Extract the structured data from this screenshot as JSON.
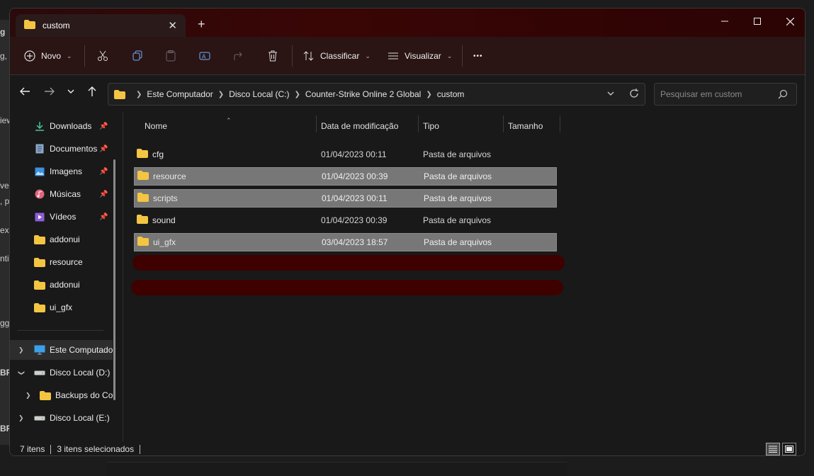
{
  "background": {
    "fragments": [
      "g",
      "g, c",
      "iew",
      "ve",
      ", p",
      "ex",
      "nti",
      "gg",
      "BR",
      "BR"
    ]
  },
  "window": {
    "tab_title": "custom",
    "new_tab": "+"
  },
  "toolbar": {
    "new_label": "Novo",
    "sort_label": "Classificar",
    "view_label": "Visualizar",
    "more_label": "•••"
  },
  "address": {
    "crumbs": [
      "Este Computador",
      "Disco Local (C:)",
      "Counter-Strike Online 2 Global",
      "custom"
    ]
  },
  "search": {
    "placeholder": "Pesquisar em custom"
  },
  "sidebar": {
    "quick_access": [
      {
        "label": "Downloads",
        "pinned": true
      },
      {
        "label": "Documentos",
        "pinned": true
      },
      {
        "label": "Imagens",
        "pinned": true
      },
      {
        "label": "Músicas",
        "pinned": true
      },
      {
        "label": "Vídeos",
        "pinned": true
      },
      {
        "label": "addonui",
        "pinned": false
      },
      {
        "label": "resource",
        "pinned": false
      },
      {
        "label": "addonui",
        "pinned": false
      },
      {
        "label": "ui_gfx",
        "pinned": false
      }
    ],
    "tree": [
      {
        "label": "Este Computador"
      },
      {
        "label": "Disco Local (D:)"
      },
      {
        "label": "Backups do Co"
      },
      {
        "label": "Disco Local (E:)"
      }
    ]
  },
  "columns": {
    "name": "Nome",
    "date": "Data de modificação",
    "type": "Tipo",
    "size": "Tamanho"
  },
  "files": [
    {
      "name": "cfg",
      "date": "01/04/2023 00:11",
      "type": "Pasta de arquivos",
      "selected": false
    },
    {
      "name": "resource",
      "date": "01/04/2023 00:39",
      "type": "Pasta de arquivos",
      "selected": true
    },
    {
      "name": "scripts",
      "date": "01/04/2023 00:11",
      "type": "Pasta de arquivos",
      "selected": true
    },
    {
      "name": "sound",
      "date": "01/04/2023 00:39",
      "type": "Pasta de arquivos",
      "selected": false
    },
    {
      "name": "ui_gfx",
      "date": "03/04/2023 18:57",
      "type": "Pasta de arquivos",
      "selected": true
    }
  ],
  "status": {
    "items": "7 itens",
    "selected": "3 itens selecionados"
  },
  "colors": {
    "accent_titlebar": "#3a0505",
    "redaction": "#3f0000",
    "selection": "#777777",
    "folder": "#f4c542"
  }
}
